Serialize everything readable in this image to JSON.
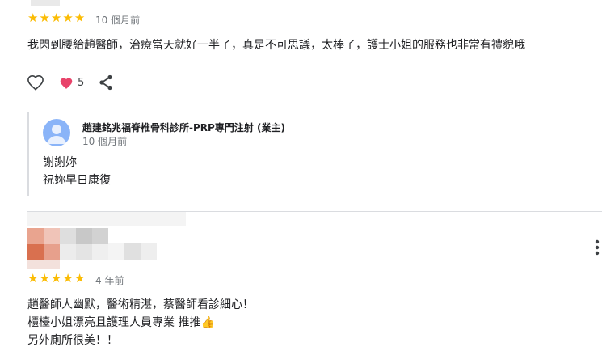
{
  "review1": {
    "stars": [
      "★",
      "★",
      "★",
      "★",
      "★"
    ],
    "time": "10 個月前",
    "text": "我閃到腰給趙醫師，治療當天就好一半了，真是不可思議，太棒了，護士小姐的服務也非常有禮貌哦",
    "like_count": "5",
    "icons": {
      "like": "heart-outline-icon",
      "reaction": "heart-filled-icon",
      "share": "share-icon"
    }
  },
  "owner_reply": {
    "name": "趙建銘兆福脊椎骨科診所-PRP專門注射 (業主)",
    "time": "10 個月前",
    "lines": [
      "謝謝妳",
      "祝妳早日康復"
    ],
    "icons": {
      "avatar": "user-avatar-icon"
    }
  },
  "review2": {
    "stars": [
      "★",
      "★",
      "★",
      "★",
      "★"
    ],
    "time": "4 年前",
    "lines": [
      "趙醫師人幽默，醫術精湛，蔡醫師看診細心！",
      "櫃檯小姐漂亮且護理人員專業 推推👍",
      "另外廁所很美！！"
    ],
    "icons": {
      "more": "more-vert-icon"
    }
  },
  "colors": {
    "star": "#fbbc04",
    "heart": "#e8436a",
    "avatar": "#8ab4f8"
  }
}
